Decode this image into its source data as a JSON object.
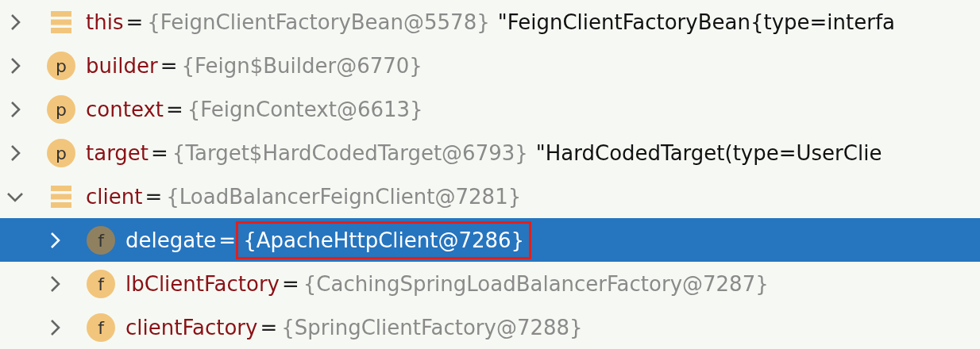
{
  "variables": [
    {
      "kind": "object",
      "name": "this",
      "separator": "=",
      "value": "{FeignClientFactoryBean@5578}",
      "description": "\"FeignClientFactoryBean{type=interfa",
      "expanded": false,
      "selected": false,
      "outlined": false
    },
    {
      "kind": "param",
      "badge": "p",
      "name": "builder",
      "separator": "=",
      "value": "{Feign$Builder@6770}",
      "expanded": false,
      "selected": false,
      "outlined": false
    },
    {
      "kind": "param",
      "badge": "p",
      "name": "context",
      "separator": "=",
      "value": "{FeignContext@6613}",
      "expanded": false,
      "selected": false,
      "outlined": false
    },
    {
      "kind": "param",
      "badge": "p",
      "name": "target",
      "separator": "=",
      "value": "{Target$HardCodedTarget@6793}",
      "description": "\"HardCodedTarget(type=UserClie",
      "expanded": false,
      "selected": false,
      "outlined": false
    },
    {
      "kind": "object",
      "name": "client",
      "separator": "=",
      "value": "{LoadBalancerFeignClient@7281}",
      "expanded": true,
      "selected": false,
      "outlined": false,
      "children": [
        {
          "kind": "field",
          "badge": "f",
          "name": "delegate",
          "separator": "=",
          "value": "{ApacheHttpClient@7286}",
          "expanded": false,
          "selected": true,
          "outlined": true
        },
        {
          "kind": "field",
          "badge": "f",
          "name": "lbClientFactory",
          "separator": "=",
          "value": "{CachingSpringLoadBalancerFactory@7287}",
          "expanded": false,
          "selected": false,
          "outlined": false
        },
        {
          "kind": "field",
          "badge": "f",
          "name": "clientFactory",
          "separator": "=",
          "value": "{SpringClientFactory@7288}",
          "expanded": false,
          "selected": false,
          "outlined": false
        }
      ]
    }
  ]
}
